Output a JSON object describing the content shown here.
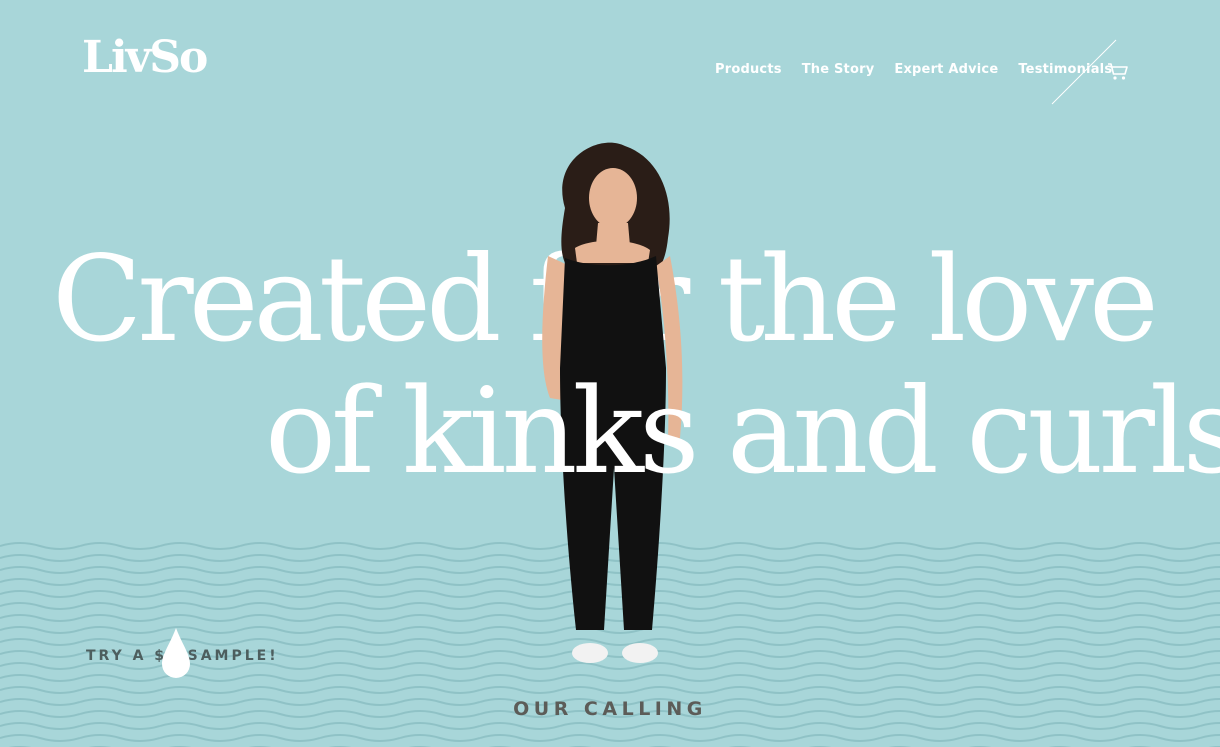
{
  "brand": {
    "logo_text": "LivSo"
  },
  "nav": {
    "items": [
      "Products",
      "The Story",
      "Expert Advice",
      "Testimonials"
    ]
  },
  "hero": {
    "headline_line1": "Created for the love",
    "headline_line2": "of kinks and curls"
  },
  "cta": {
    "sample_label": "TRY A $2 SAMPLE!"
  },
  "section": {
    "title": "OUR CALLING"
  },
  "icons": {
    "cart": "cart-icon",
    "drop": "water-drop-icon"
  },
  "colors": {
    "background": "#a8d6d9",
    "text_light": "#ffffff",
    "wave": "#8fc2c6",
    "dark_text": "#5c5c58"
  }
}
